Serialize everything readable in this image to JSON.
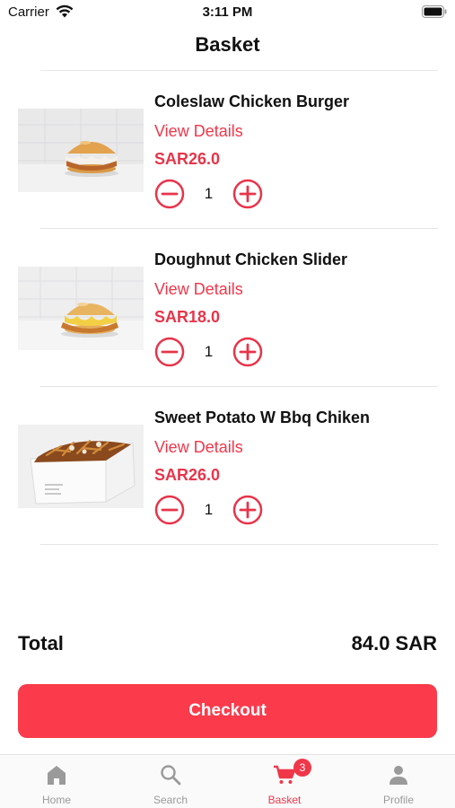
{
  "status_bar": {
    "carrier": "Carrier",
    "time": "3:11 PM"
  },
  "header": {
    "title": "Basket"
  },
  "items": [
    {
      "name": "Coleslaw Chicken Burger",
      "details_label": "View Details",
      "price": "SAR26.0",
      "quantity": "1"
    },
    {
      "name": "Doughnut Chicken Slider",
      "details_label": "View Details",
      "price": "SAR18.0",
      "quantity": "1"
    },
    {
      "name": "Sweet Potato W Bbq Chiken",
      "details_label": "View Details",
      "price": "SAR26.0",
      "quantity": "1"
    }
  ],
  "summary": {
    "total_label": "Total",
    "total_value": "84.0 SAR"
  },
  "checkout": {
    "label": "Checkout"
  },
  "tabs": [
    {
      "label": "Home",
      "icon": "home-icon"
    },
    {
      "label": "Search",
      "icon": "search-icon"
    },
    {
      "label": "Basket",
      "icon": "cart-icon",
      "badge": "3",
      "active": true
    },
    {
      "label": "Profile",
      "icon": "person-icon"
    }
  ],
  "colors": {
    "accent": "#f0374a",
    "checkout": "#fb3a4b",
    "inactive_tab": "#9a9a9a"
  }
}
